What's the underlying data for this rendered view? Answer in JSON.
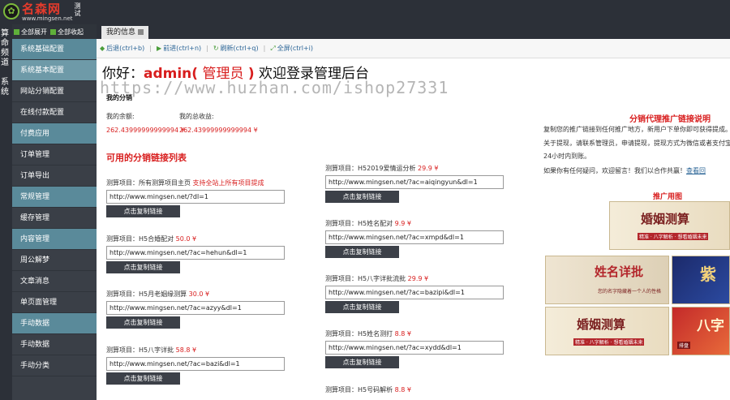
{
  "header": {
    "logo_mark": "✿",
    "brand": "名森网",
    "url": "www.mingsen.net",
    "tag": "测试"
  },
  "leftcol": {
    "group1": "算命频道",
    "group2": "系统"
  },
  "sidebar": {
    "expand_all": "全部展开",
    "collapse_all": "全部收起",
    "items": [
      {
        "label": "系统基础配置",
        "kind": "head"
      },
      {
        "label": "系统基本配置",
        "kind": "active"
      },
      {
        "label": "网站分销配置",
        "kind": "normal"
      },
      {
        "label": "在线付款配置",
        "kind": "normal"
      },
      {
        "label": "付费应用",
        "kind": "head"
      },
      {
        "label": "订单管理",
        "kind": "normal"
      },
      {
        "label": "订单导出",
        "kind": "normal"
      },
      {
        "label": "常规管理",
        "kind": "head"
      },
      {
        "label": "缓存管理",
        "kind": "normal"
      },
      {
        "label": "内容管理",
        "kind": "head"
      },
      {
        "label": "周公解梦",
        "kind": "normal"
      },
      {
        "label": "文章消息",
        "kind": "normal"
      },
      {
        "label": "单页面管理",
        "kind": "normal"
      },
      {
        "label": "手动数据",
        "kind": "head"
      },
      {
        "label": "手动数据",
        "kind": "normal"
      },
      {
        "label": "手动分类",
        "kind": "normal"
      }
    ]
  },
  "tab": {
    "label": "我的信息"
  },
  "navbar": {
    "back": "后退(ctrl+b)",
    "forward": "前进(ctrl+n)",
    "refresh": "刷新(ctrl+q)",
    "fullscreen": "全屏(ctrl+i)"
  },
  "greeting": {
    "hello": "你好：",
    "name": "admin(",
    "role": " 管理员 ",
    "close": ")",
    "rest": " 欢迎登录管理后台"
  },
  "watermark": "https://www.huzhan.com/ishop27331",
  "section_title": "我的分销",
  "stats": {
    "balance_label": "我的余额:",
    "balance_value": "262.43999999999994 ¥",
    "income_label": "我的总收益:",
    "income_value": "262.43999999999994 ¥"
  },
  "list_title": "可用的分销链接列表",
  "button_label": "点击复制链接",
  "projects_left": [
    {
      "label": "测算项目：",
      "name": "所有测算项目主页 ",
      "price": "",
      "note": "支持全站上所有项目提成",
      "url": "http://www.mingsen.net/?dl=1"
    },
    {
      "label": "测算项目：",
      "name": "H5合婚配对 ",
      "price": "50.0 ¥",
      "note": "",
      "url": "http://www.mingsen.net/?ac=hehun&dl=1"
    },
    {
      "label": "测算项目：",
      "name": "H5月老姻缘测算 ",
      "price": "30.0 ¥",
      "note": "",
      "url": "http://www.mingsen.net/?ac=azyy&dl=1"
    },
    {
      "label": "测算项目：",
      "name": "H5八字详批 ",
      "price": "58.8 ¥",
      "note": "",
      "url": "http://www.mingsen.net/?ac=bazi&dl=1"
    }
  ],
  "projects_right": [
    {
      "label": "测算项目：",
      "name": "H52019爱情运分析 ",
      "price": "29.9 ¥",
      "note": "",
      "url": "http://www.mingsen.net/?ac=aiqingyun&dl=1"
    },
    {
      "label": "测算项目：",
      "name": "H5姓名配对 ",
      "price": "9.9 ¥",
      "note": "",
      "url": "http://www.mingsen.net/?ac=xmpd&dl=1"
    },
    {
      "label": "测算项目：",
      "name": "H5八字详批流批 ",
      "price": "29.9 ¥",
      "note": "",
      "url": "http://www.mingsen.net/?ac=bazipi&dl=1"
    },
    {
      "label": "测算项目：",
      "name": "H5姓名测打 ",
      "price": "8.8 ¥",
      "note": "",
      "url": "http://www.mingsen.net/?ac=xydd&dl=1"
    },
    {
      "label": "测算项目：",
      "name": "H5号码解析 ",
      "price": "8.8 ¥",
      "note": "",
      "url": ""
    }
  ],
  "right": {
    "title": "分销代理推广链接说明",
    "line1": "复制您的推广链接到任何推广地方，新用户下单你即可获得提成。",
    "line2": "关于提现，请联系管理员，申请提现，提现方式为微信或者支付宝，",
    "line3": "24小时内到账。",
    "line4_pre": "如果你有任何疑问，欢迎留言！我们以合作共赢！",
    "line4_link": "查看回",
    "banner_title": "推广用图",
    "banners": [
      {
        "text": "婚姻测算",
        "sub": "精准 · 八字解析 · 想看婚姻未来"
      },
      {
        "text": "姓名详批",
        "sub": "您的名字隐藏着一个人的性格"
      },
      {
        "text": "紫",
        "sub": ""
      },
      {
        "text": "婚姻测算",
        "sub": "精准 · 八字解析 · 想看婚姻未来"
      },
      {
        "text": "八字",
        "sub": "排盘"
      }
    ]
  },
  "colors": {
    "accent_red": "#d81e1e",
    "sidebar_bg": "#3a3f47",
    "sidebar_head": "#5a8a9a",
    "topbar_bg": "#2c3038",
    "link_blue": "#2a6496",
    "button_bg": "#3c4048"
  }
}
